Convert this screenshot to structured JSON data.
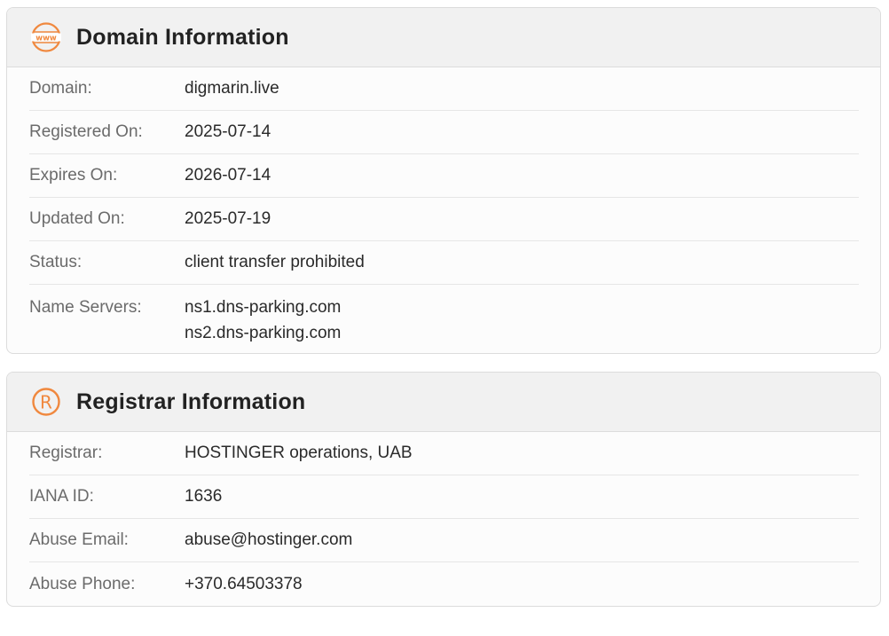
{
  "domain_card": {
    "title": "Domain Information",
    "icon": "www-globe-icon",
    "rows": [
      {
        "label": "Domain:",
        "value": "digmarin.live"
      },
      {
        "label": "Registered On:",
        "value": "2025-07-14"
      },
      {
        "label": "Expires On:",
        "value": "2026-07-14"
      },
      {
        "label": "Updated On:",
        "value": "2025-07-19"
      },
      {
        "label": "Status:",
        "value": "client transfer prohibited"
      },
      {
        "label": "Name Servers:",
        "values": [
          "ns1.dns-parking.com",
          "ns2.dns-parking.com"
        ]
      }
    ]
  },
  "registrar_card": {
    "title": "Registrar Information",
    "icon": "registered-icon",
    "rows": [
      {
        "label": "Registrar:",
        "value": "HOSTINGER operations, UAB"
      },
      {
        "label": "IANA ID:",
        "value": "1636"
      },
      {
        "label": "Abuse Email:",
        "value": "abuse@hostinger.com"
      },
      {
        "label": "Abuse Phone:",
        "value": "+370.64503378"
      }
    ]
  },
  "colors": {
    "accent": "#f0883e",
    "header_bg": "#f1f1f1",
    "border": "#dcdcdc",
    "label_text": "#6b6b6b",
    "value_text": "#2a2a2a"
  }
}
